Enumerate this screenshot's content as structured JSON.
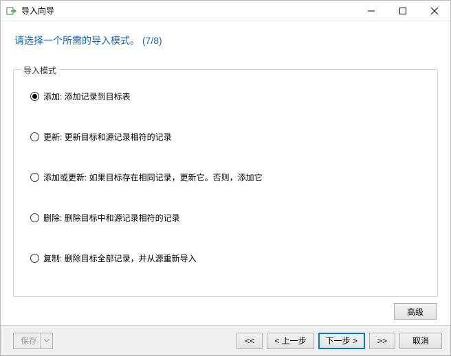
{
  "window": {
    "title": "导入向导"
  },
  "header": {
    "instruction": "请选择一个所需的导入模式。 (7/8)"
  },
  "fieldset": {
    "legend": "导入模式",
    "options": [
      {
        "label": "添加: 添加记录到目标表",
        "checked": true
      },
      {
        "label": "更新: 更新目标和源记录相符的记录",
        "checked": false
      },
      {
        "label": "添加或更新: 如果目标存在相同记录，更新它。否则，添加它",
        "checked": false
      },
      {
        "label": "删除: 删除目标中和源记录相符的记录",
        "checked": false
      },
      {
        "label": "复制: 删除目标全部记录，并从源重新导入",
        "checked": false
      }
    ]
  },
  "buttons": {
    "advanced": "高级",
    "save": "保存",
    "first": "<<",
    "prev": "< 上一步",
    "next": "下一步 >",
    "last": ">>",
    "cancel": "取消"
  }
}
